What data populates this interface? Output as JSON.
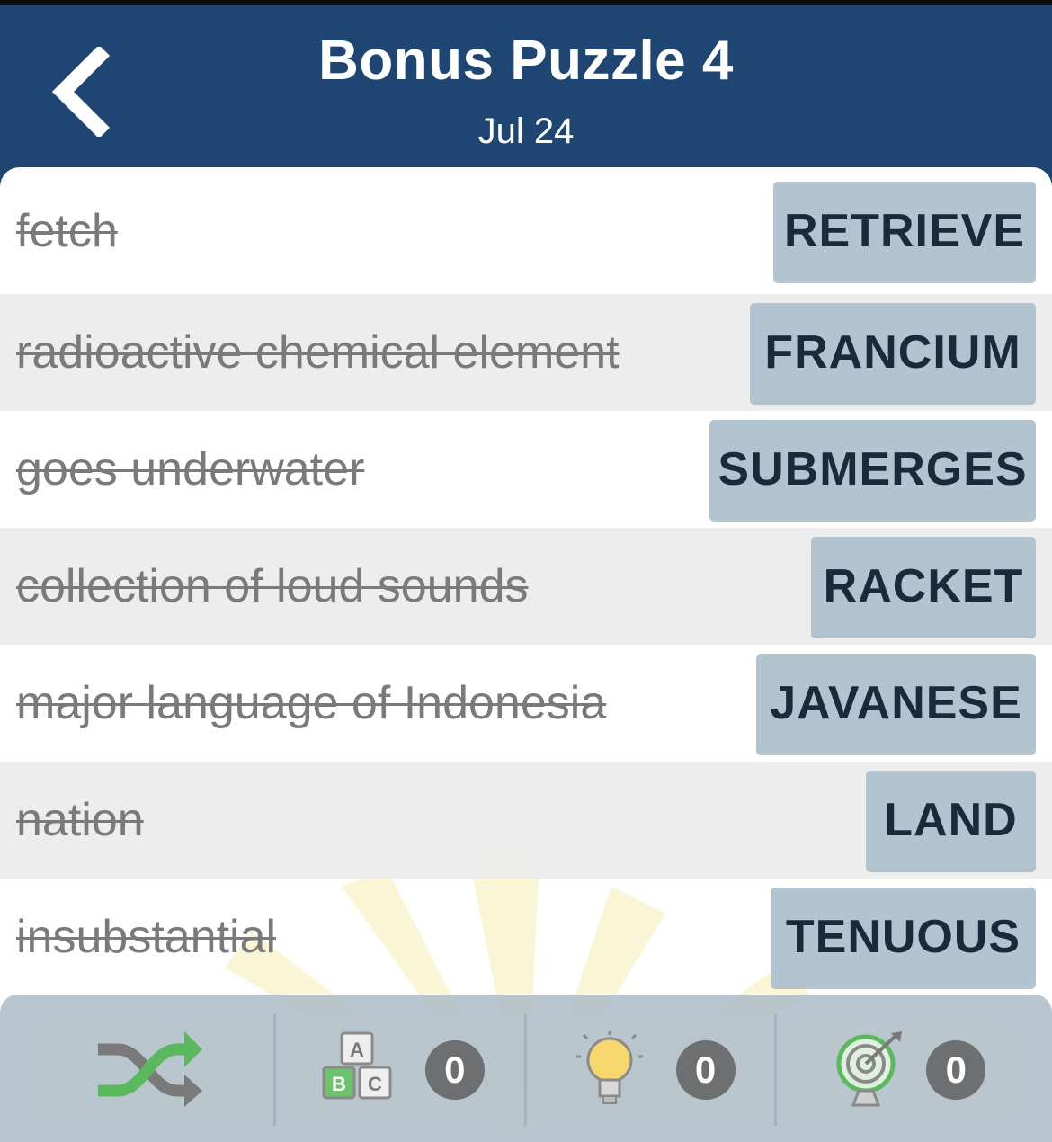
{
  "header": {
    "title": "Bonus Puzzle 4",
    "date": "Jul 24"
  },
  "clues": [
    {
      "clue": "fetch",
      "answer": "RETRIEVE"
    },
    {
      "clue": "radioactive chemical element",
      "answer": "FRANCIUM"
    },
    {
      "clue": "goes underwater",
      "answer": "SUBMERGES"
    },
    {
      "clue": "collection of loud sounds",
      "answer": "RACKET"
    },
    {
      "clue": "major language of Indonesia",
      "answer": "JAVANESE"
    },
    {
      "clue": "nation",
      "answer": "LAND"
    },
    {
      "clue": "insubstantial",
      "answer": "TENUOUS"
    }
  ],
  "toolbar": {
    "shuffle_icon": "shuffle-icon",
    "letters_icon": "abc-blocks-icon",
    "letters_count": "0",
    "hint_icon": "lightbulb-icon",
    "hint_count": "0",
    "target_icon": "target-icon",
    "target_count": "0"
  },
  "colors": {
    "header_bg": "#1f4672",
    "answer_tile": "#b3c4d1",
    "shuffle_green": "#5cb85c",
    "bulb_yellow": "#f5d76e"
  }
}
